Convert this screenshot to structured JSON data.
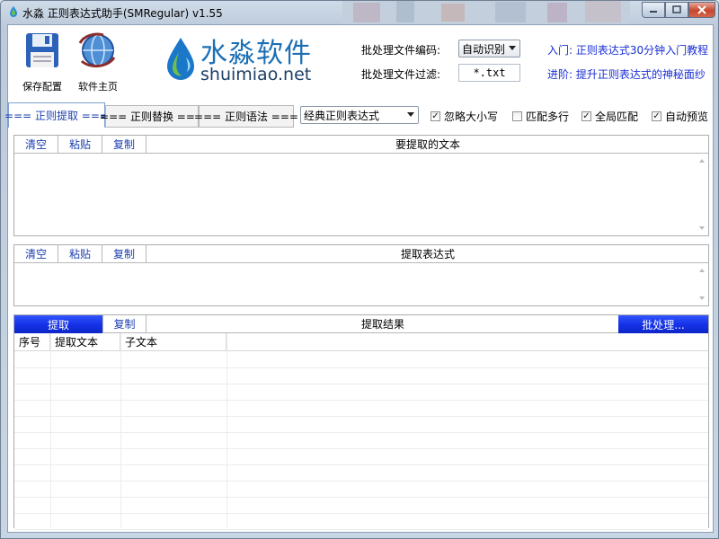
{
  "window": {
    "title": "水淼 正则表达式助手(SMRegular) v1.55"
  },
  "toolbar": {
    "save_config_label": "保存配置",
    "homepage_label": "软件主页"
  },
  "brand": {
    "name": "水淼软件",
    "domain": "shuimiao.net"
  },
  "batch": {
    "encoding_label": "批处理文件编码:",
    "encoding_value": "自动识别",
    "filter_label": "批处理文件过滤:",
    "filter_value": "*.txt"
  },
  "links": {
    "intro": "入门: 正则表达式30分钟入门教程",
    "advanced": "进阶: 提升正则表达式的神秘面纱"
  },
  "tabs": [
    {
      "label": "=== 正则提取 ===",
      "active": true
    },
    {
      "label": "=== 正则替换 ===",
      "active": false
    },
    {
      "label": "=== 正则语法 ===",
      "active": false
    }
  ],
  "regex_type": {
    "value": "经典正则表达式"
  },
  "options": [
    {
      "label": "忽略大小写",
      "checked": true
    },
    {
      "label": "匹配多行",
      "checked": false
    },
    {
      "label": "全局匹配",
      "checked": true
    },
    {
      "label": "自动预览",
      "checked": true
    }
  ],
  "source_section": {
    "clear": "清空",
    "paste": "粘贴",
    "copy": "复制",
    "caption": "要提取的文本"
  },
  "expr_section": {
    "clear": "清空",
    "paste": "粘贴",
    "copy": "复制",
    "caption": "提取表达式"
  },
  "result_section": {
    "extract": "提取",
    "copy": "复制",
    "caption": "提取结果",
    "batch": "批处理...",
    "columns": [
      "序号",
      "提取文本",
      "子文本"
    ]
  },
  "colors": {
    "accent": "#1b3fb0",
    "link": "#1a2fd6",
    "button_blue": "#1432e8"
  }
}
